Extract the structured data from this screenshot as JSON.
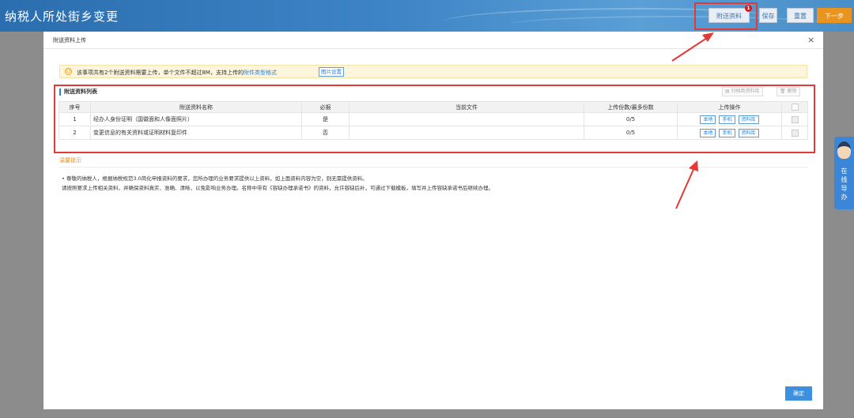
{
  "app": {
    "title": "纳税人所处街乡变更"
  },
  "toolbar": {
    "attach": "附送资料",
    "badge": "1",
    "save": "保存",
    "reset": "重置",
    "next": "下一步"
  },
  "dialog": {
    "title": "附送资料上传",
    "close": "×",
    "notice": {
      "text": "该事项共有2个附送资料需要上传，单个文件不超过8M，支持上传的",
      "link": "附件类型格式",
      "button": "图片设置"
    },
    "section_title": "附送资料列表",
    "tools": {
      "archive": "归档到资料库",
      "delete": "删除"
    },
    "table": {
      "headers": [
        "序号",
        "附送资料名称",
        "必报",
        "当前文件",
        "上传份数/最多份数",
        "上传操作"
      ],
      "rows": [
        {
          "index": "1",
          "name": "经办人身份证明（国徽面和人像面照片）",
          "required": "是",
          "file": "",
          "count": "0/5"
        },
        {
          "index": "2",
          "name": "变更信息的有关资料或证明材料复印件",
          "required": "否",
          "file": "",
          "count": "0/5"
        }
      ],
      "ops": [
        "本地",
        "手机",
        "资料库"
      ]
    },
    "tips_title": "温馨提示",
    "tips": [
      "• 尊敬的纳税人，根据纳税规范3.0简化申报资料的要求，您所办理的业务要求提供以上资料，如上面资料内容为空，则无需提供资料。",
      "请按照要求上传相关资料，并确保资料真实、准确、清晰，以免影响业务办理。名称中带有《容缺办理承诺书》的资料，允许容缺后补，可通过下载模板，填写并上传容缺承诺书后继续办理。"
    ],
    "ok": "确定"
  },
  "float_help": {
    "text": "在线导办"
  },
  "colors": {
    "accent": "#3d8fe0",
    "highlight": "#e53935",
    "next": "#e8941f"
  }
}
